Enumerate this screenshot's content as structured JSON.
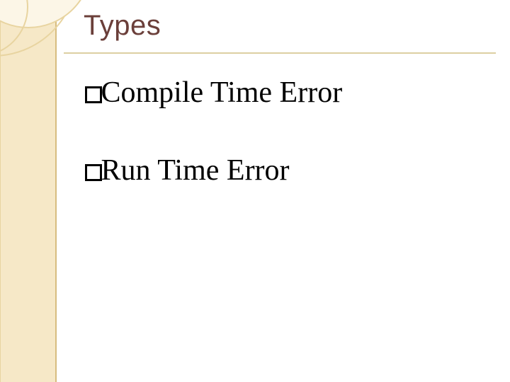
{
  "slide": {
    "title": "Types",
    "bullets": [
      {
        "text": "Compile Time Error"
      },
      {
        "text": "Run Time Error"
      }
    ]
  }
}
